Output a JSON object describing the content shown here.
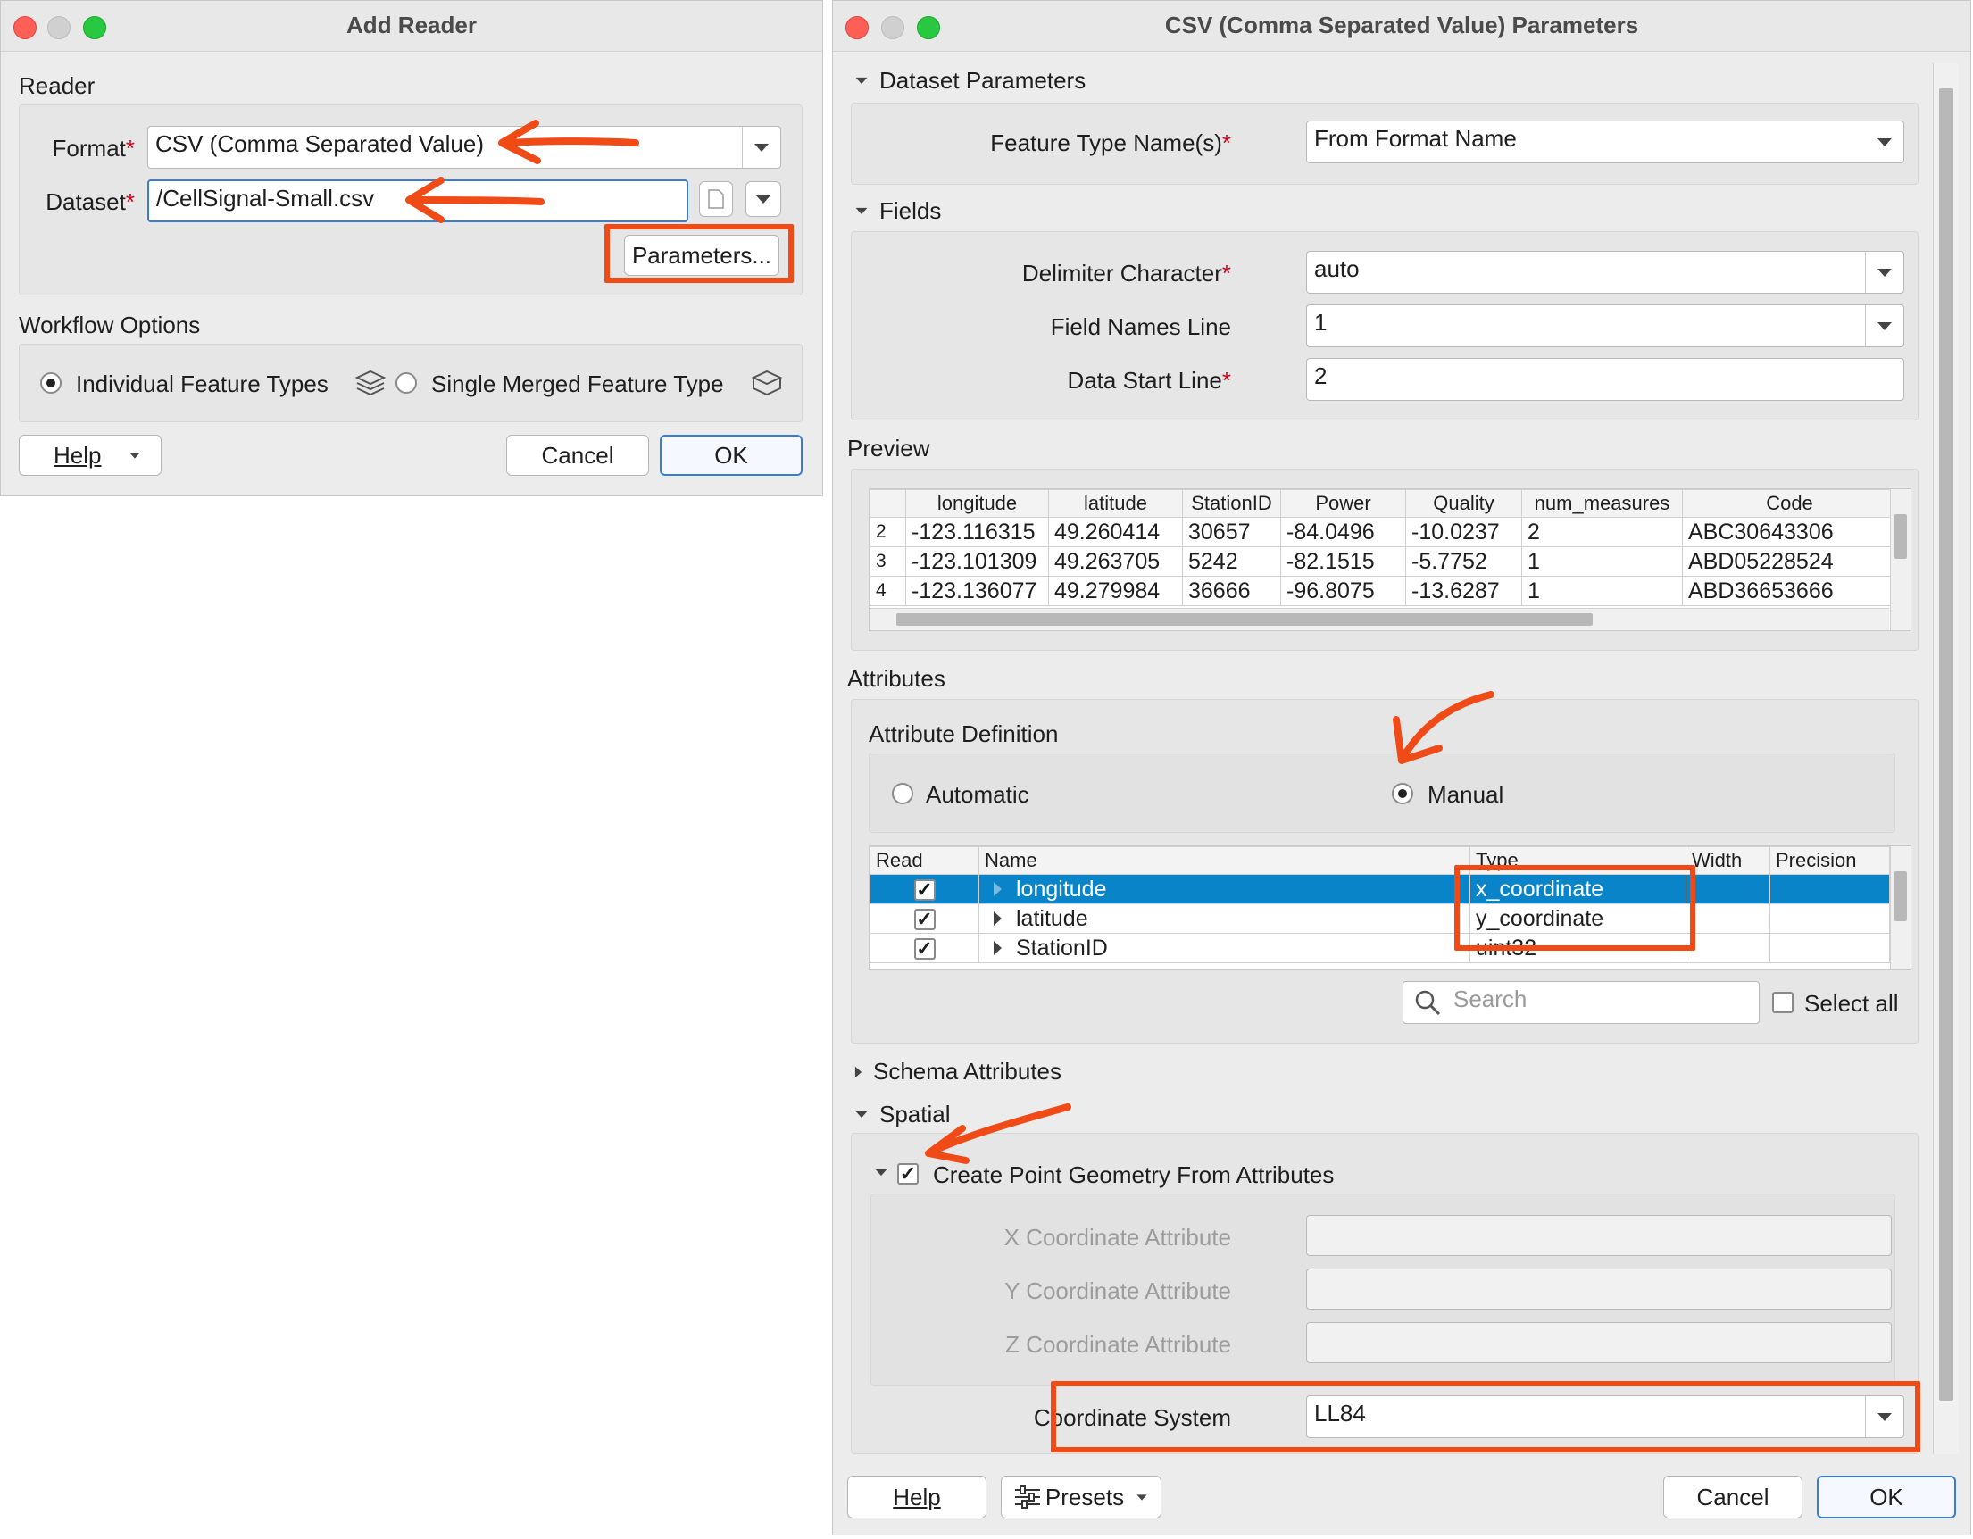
{
  "add_reader": {
    "title": "Add Reader",
    "reader_section": "Reader",
    "format_label": "Format",
    "format_value": "CSV (Comma Separated Value)",
    "dataset_label": "Dataset",
    "dataset_value": "/CellSignal-Small.csv",
    "parameters_button": "Parameters...",
    "workflow_section": "Workflow Options",
    "option_individual": "Individual Feature Types",
    "option_single": "Single Merged Feature Type",
    "selected_option": "Individual Feature Types",
    "help_button": "Help",
    "cancel_button": "Cancel",
    "ok_button": "OK"
  },
  "csv_params": {
    "title": "CSV (Comma Separated Value) Parameters",
    "dataset_parameters": {
      "header": "Dataset Parameters",
      "feature_type_label": "Feature Type Name(s)",
      "feature_type_value": "From Format Name"
    },
    "fields": {
      "header": "Fields",
      "delimiter_label": "Delimiter Character",
      "delimiter_value": "auto",
      "field_names_label": "Field Names Line",
      "field_names_value": "1",
      "data_start_label": "Data Start Line",
      "data_start_value": "2"
    },
    "preview": {
      "header": "Preview",
      "columns": [
        "longitude",
        "latitude",
        "StationID",
        "Power",
        "Quality",
        "num_measures",
        "Code"
      ],
      "rows": [
        {
          "n": "2",
          "cells": [
            "-123.116315",
            "49.260414",
            "30657",
            "-84.0496",
            "-10.0237",
            "2",
            "ABC30643306"
          ]
        },
        {
          "n": "3",
          "cells": [
            "-123.101309",
            "49.263705",
            "5242",
            "-82.1515",
            "-5.7752",
            "1",
            "ABD05228524"
          ]
        },
        {
          "n": "4",
          "cells": [
            "-123.136077",
            "49.279984",
            "36666",
            "-96.8075",
            "-13.6287",
            "1",
            "ABD36653666"
          ]
        }
      ]
    },
    "attributes": {
      "header": "Attributes",
      "definition_label": "Attribute Definition",
      "automatic": "Automatic",
      "manual": "Manual",
      "selected": "Manual",
      "columns": [
        "Read",
        "Name",
        "Type",
        "Width",
        "Precision"
      ],
      "rows": [
        {
          "read": "✓",
          "name": "longitude",
          "type": "x_coordinate",
          "selected": true
        },
        {
          "read": "✓",
          "name": "latitude",
          "type": "y_coordinate",
          "selected": false
        },
        {
          "read": "✓",
          "name": "StationID",
          "type": "uint32",
          "selected": false
        }
      ],
      "search_placeholder": "Search",
      "select_all": "Select all"
    },
    "schema_attributes": "Schema Attributes",
    "spatial": {
      "header": "Spatial",
      "create_point": "Create Point Geometry From Attributes",
      "create_point_checked": true,
      "x_label": "X Coordinate Attribute",
      "y_label": "Y Coordinate Attribute",
      "z_label": "Z Coordinate Attribute",
      "coord_sys_label": "Coordinate System",
      "coord_sys_value": "LL84"
    },
    "help_button": "Help",
    "presets_button": "Presets",
    "cancel_button": "Cancel",
    "ok_button": "OK"
  },
  "required_mark": "*",
  "annotation_color": "#f04b16"
}
